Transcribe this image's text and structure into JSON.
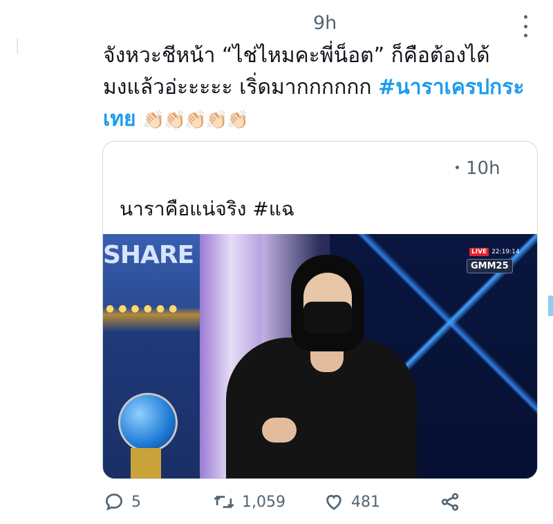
{
  "tweet": {
    "timestamp": "9h",
    "text_line1": "จังหวะชีหน้า “ไช่ไหมคะพี่น็อต” ก็คือต้องได้",
    "text_line2": "มงแล้วอ่ะะะะะ เริ่ดมากกกกกก ",
    "hashtag": "#นาราเครปกระเทย",
    "emojis": "👏🏻👏🏻👏🏻👏🏻👏🏻"
  },
  "quote": {
    "timestamp": "10h",
    "text": "นาราคือแน่จริง #แฉ",
    "media": {
      "set_sign": "SHARE",
      "live_label": "LIVE",
      "live_time": "22:19:14",
      "channel": "GMM25"
    }
  },
  "actions": {
    "reply_count": "5",
    "retweet_count": "1,059",
    "like_count": "481"
  },
  "icons": {
    "reply": "reply-icon",
    "retweet": "retweet-icon",
    "like": "heart-icon",
    "share": "share-icon",
    "more": "more-icon"
  },
  "colors": {
    "hashtag": "#1d9bf0",
    "secondary_text": "#536471",
    "border": "#cfd9de"
  }
}
